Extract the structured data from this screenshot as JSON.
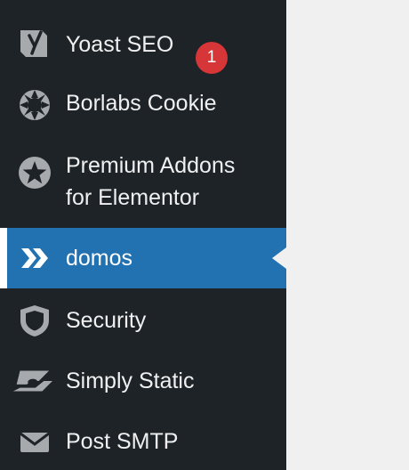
{
  "menu": {
    "items": [
      {
        "label": "Yoast SEO",
        "icon": "yoast-icon",
        "badge": "1"
      },
      {
        "label": "Borlabs Cookie",
        "icon": "cookie-icon"
      },
      {
        "label_line1": "Premium Addons",
        "label_line2": "for Elementor",
        "icon": "star-badge-icon"
      },
      {
        "label": "domos",
        "icon": "double-chevron-icon",
        "active": true
      },
      {
        "label": "Security",
        "icon": "shield-icon"
      },
      {
        "label": "Simply Static",
        "icon": "simply-static-icon"
      },
      {
        "label": "Post SMTP",
        "icon": "envelope-icon"
      }
    ]
  },
  "colors": {
    "sidebar_bg": "#1d2327",
    "active_bg": "#2271b1",
    "text": "#f0f0f1",
    "icon": "#a7aaad",
    "badge": "#d63638",
    "page_bg": "#f0f0f1"
  }
}
